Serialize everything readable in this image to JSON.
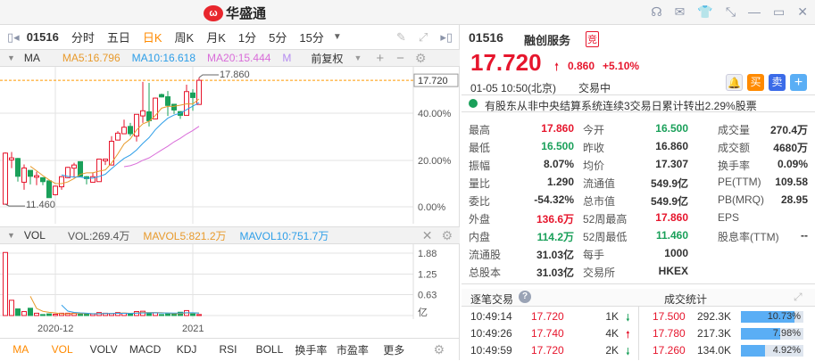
{
  "app": {
    "brand": "华盛通",
    "logo_mark": "W"
  },
  "window_icons": [
    "headset-icon",
    "mail-icon",
    "shirt-icon",
    "shrink-icon",
    "minimize-icon",
    "maximize-icon",
    "close-icon"
  ],
  "toolbar": {
    "code": "01516",
    "periods": [
      "分时",
      "五日",
      "日K",
      "周K",
      "月K",
      "1分",
      "5分",
      "15分"
    ],
    "active": "日K"
  },
  "ma_row": {
    "name": "MA",
    "ma5": "MA5:16.796",
    "ma10": "MA10:16.618",
    "ma20": "MA20:15.444",
    "ma_more": "MA",
    "adjust": "前复权"
  },
  "price_axis": {
    "current": "17.720",
    "ticks": [
      "40.00%",
      "20.00%",
      "0.00%"
    ],
    "high_label": "17.860",
    "low_label": "11.460"
  },
  "vol_row": {
    "name": "VOL",
    "vol": "VOL:269.4万",
    "mavol5": "MAVOL5:821.2万",
    "mavol10": "MAVOL10:751.7万",
    "ticks": [
      "1.88",
      "1.25",
      "0.63",
      "亿"
    ]
  },
  "date_axis": [
    "2020-12",
    "2021"
  ],
  "indicator_tabs": [
    "MA",
    "VOL",
    "VOLV",
    "MACD",
    "KDJ",
    "RSI",
    "BOLL",
    "换手率",
    "市盈率",
    "更多"
  ],
  "chart_data": {
    "type": "candlestick",
    "colors": {
      "up": "#e6162d",
      "down": "#1aa05a",
      "ma5": "#e89a2c",
      "ma10": "#2d9ee8",
      "ma20": "#d96cd9"
    },
    "ohlc": [
      [
        11.46,
        14.08,
        11.46,
        14.04
      ],
      [
        13.7,
        14.1,
        13.28,
        13.8
      ],
      [
        13.77,
        13.8,
        12.6,
        12.87
      ],
      [
        12.57,
        13.47,
        12.19,
        13.29
      ],
      [
        13.17,
        13.17,
        12.46,
        12.87
      ],
      [
        12.82,
        13.1,
        12.42,
        12.9
      ],
      [
        12.8,
        12.82,
        12.42,
        12.6
      ],
      [
        12.64,
        12.64,
        11.79,
        11.79
      ],
      [
        11.94,
        12.4,
        11.9,
        12.37
      ],
      [
        12.34,
        12.88,
        12.19,
        12.85
      ],
      [
        12.8,
        13.35,
        12.78,
        13.32
      ],
      [
        13.28,
        13.55,
        12.8,
        13.44
      ],
      [
        13.61,
        13.61,
        12.87,
        12.87
      ],
      [
        12.85,
        12.88,
        12.46,
        12.75
      ],
      [
        12.57,
        13.07,
        12.55,
        12.85
      ],
      [
        12.6,
        13.74,
        12.6,
        13.74
      ],
      [
        13.65,
        13.76,
        13.44,
        13.74
      ],
      [
        13.44,
        14.9,
        13.44,
        14.64
      ],
      [
        14.7,
        15.15,
        14.68,
        15.05
      ],
      [
        15.02,
        15.73,
        15.0,
        15.35
      ],
      [
        15.39,
        15.57,
        14.9,
        15.02
      ],
      [
        14.9,
        16.0,
        14.63,
        16.0
      ],
      [
        15.92,
        17.64,
        15.57,
        16.18
      ],
      [
        16.13,
        17.59,
        15.39,
        15.68
      ],
      [
        15.77,
        16.85,
        15.75,
        16.82
      ],
      [
        17.0,
        17.05,
        16.85,
        16.88
      ],
      [
        16.89,
        17.18,
        15.92,
        16.45
      ],
      [
        16.51,
        16.51,
        16.02,
        16.22
      ],
      [
        16.14,
        16.16,
        15.77,
        15.95
      ],
      [
        15.95,
        17.5,
        15.95,
        17.15
      ],
      [
        17.08,
        17.27,
        16.18,
        16.85
      ],
      [
        16.5,
        17.86,
        16.5,
        17.72
      ]
    ],
    "volume_yi": [
      1.9,
      0.46,
      0.2,
      0.12,
      0.22,
      0.07,
      0.03,
      0.05,
      0.04,
      0.07,
      0.07,
      0.07,
      0.05,
      0.05,
      0.05,
      0.09,
      0.07,
      0.06,
      0.09,
      0.07,
      0.05,
      0.12,
      0.13,
      0.08,
      0.08,
      0.03,
      0.05,
      0.05,
      0.1,
      0.15,
      0.05,
      0.03
    ],
    "price_range": [
      11.46,
      17.86
    ],
    "volume_range": [
      0,
      1.88
    ]
  },
  "quote": {
    "code": "01516",
    "name": "融创服务",
    "badge": "竞",
    "price": "17.720",
    "change": "0.860",
    "pct": "+5.10%",
    "time": "01-05  10:50(北京)",
    "status": "交易中",
    "buy": "买",
    "sell": "卖",
    "notice": "有股东从非中央结算系统连续3交易日累计转出2.29%股票"
  },
  "stats": [
    [
      {
        "l": "最高",
        "v": "17.860",
        "c": "red"
      },
      {
        "l": "今开",
        "v": "16.500",
        "c": "green"
      },
      {
        "l": "成交量",
        "v": "270.4万",
        "c": ""
      }
    ],
    [
      {
        "l": "最低",
        "v": "16.500",
        "c": "green"
      },
      {
        "l": "昨收",
        "v": "16.860",
        "c": ""
      },
      {
        "l": "成交额",
        "v": "4680万",
        "c": ""
      }
    ],
    [
      {
        "l": "振幅",
        "v": "8.07%",
        "c": ""
      },
      {
        "l": "均价",
        "v": "17.307",
        "c": ""
      },
      {
        "l": "换手率",
        "v": "0.09%",
        "c": ""
      }
    ],
    [
      {
        "l": "量比",
        "v": "1.290",
        "c": ""
      },
      {
        "l": "流通值",
        "v": "549.9亿",
        "c": ""
      },
      {
        "l": "PE(TTM)",
        "v": "109.58",
        "c": ""
      }
    ],
    [
      {
        "l": "委比",
        "v": "-54.32%",
        "c": ""
      },
      {
        "l": "总市值",
        "v": "549.9亿",
        "c": ""
      },
      {
        "l": "PB(MRQ)",
        "v": "28.95",
        "c": ""
      }
    ],
    [
      {
        "l": "外盘",
        "v": "136.6万",
        "c": "red"
      },
      {
        "l": "52周最高",
        "v": "17.860",
        "c": "red"
      },
      {
        "l": "EPS",
        "v": "",
        "c": ""
      }
    ],
    [
      {
        "l": "内盘",
        "v": "114.2万",
        "c": "green"
      },
      {
        "l": "52周最低",
        "v": "11.460",
        "c": "green"
      },
      {
        "l": "股息率(TTM)",
        "v": "--",
        "c": ""
      }
    ],
    [
      {
        "l": "流通股",
        "v": "31.03亿",
        "c": ""
      },
      {
        "l": "每手",
        "v": "1000",
        "c": ""
      },
      {
        "l": "",
        "v": "",
        "c": ""
      }
    ],
    [
      {
        "l": "总股本",
        "v": "31.03亿",
        "c": ""
      },
      {
        "l": "交易所",
        "v": "HKEX",
        "c": ""
      },
      {
        "l": "",
        "v": "",
        "c": ""
      }
    ]
  ],
  "ticks_panel": {
    "title": "逐笔交易",
    "stats_title": "成交统计",
    "trades": [
      {
        "time": "10:49:14",
        "price": "17.720",
        "vol": "1K",
        "dir": "down"
      },
      {
        "time": "10:49:26",
        "price": "17.740",
        "vol": "4K",
        "dir": "up"
      },
      {
        "time": "10:49:59",
        "price": "17.720",
        "vol": "2K",
        "dir": "down"
      }
    ],
    "dist": [
      {
        "price": "17.500",
        "vol": "292.3K",
        "pct": "10.73%",
        "frac": 0.1073
      },
      {
        "price": "17.780",
        "vol": "217.3K",
        "pct": "7.98%",
        "frac": 0.0798
      },
      {
        "price": "17.260",
        "vol": "134.0K",
        "pct": "4.92%",
        "frac": 0.0492
      }
    ]
  }
}
